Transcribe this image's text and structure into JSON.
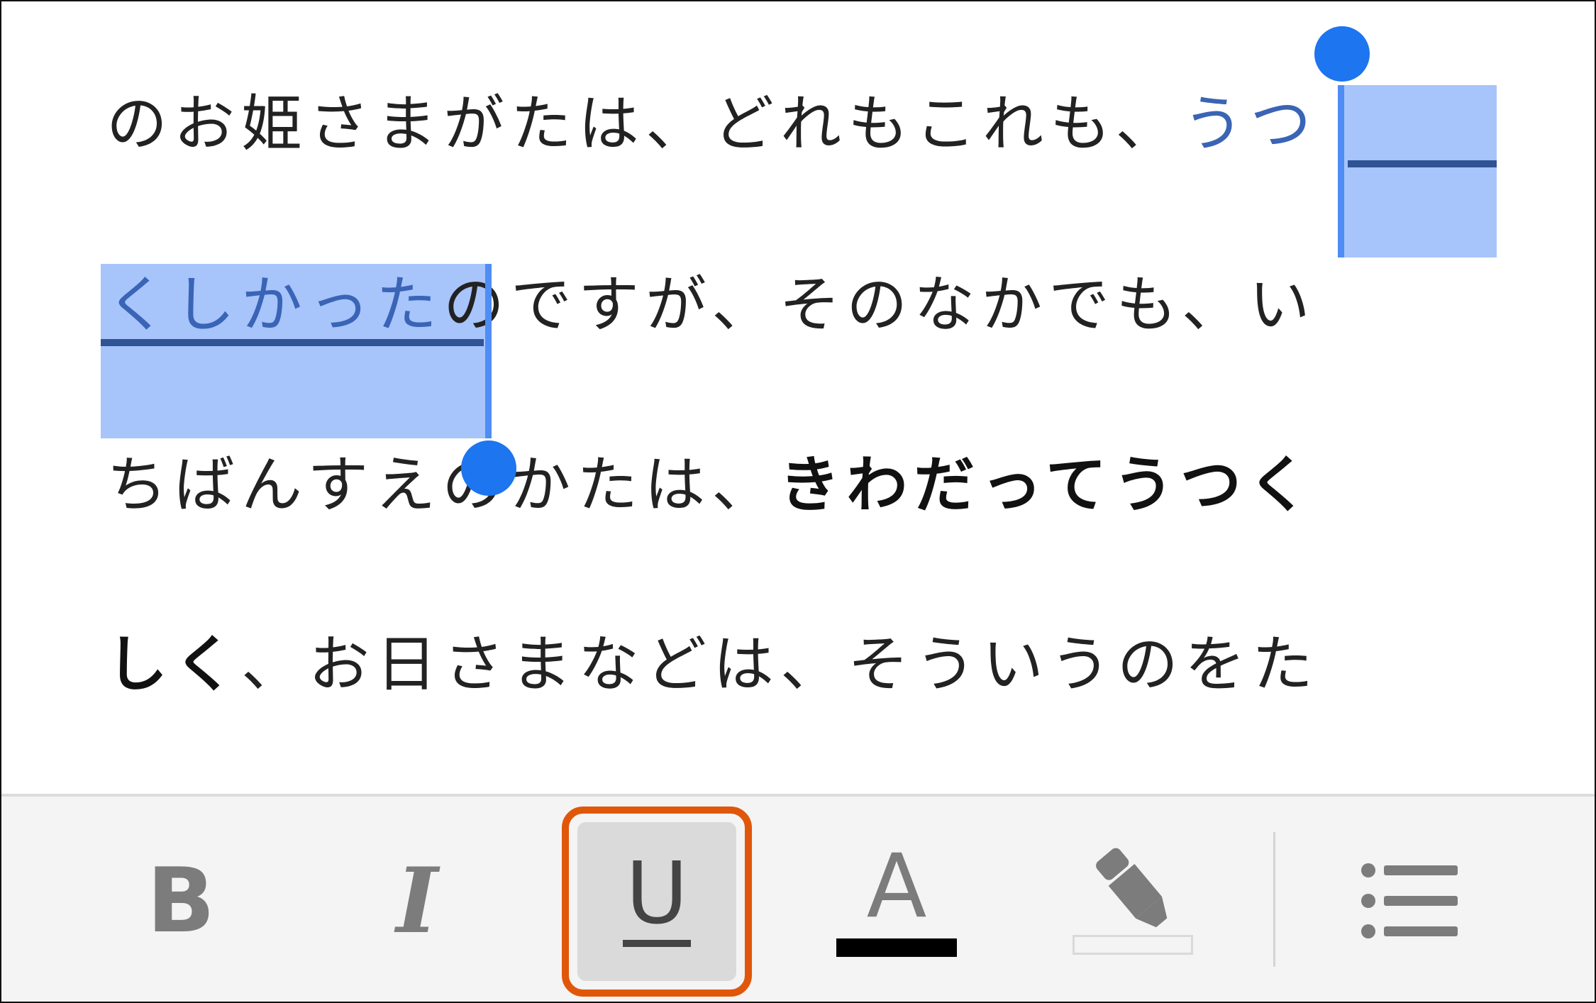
{
  "editor": {
    "lines": [
      {
        "before": "のお姫さまがたは、どれもこれも、",
        "selected": "うつ"
      },
      {
        "selected": "くしかった",
        "after": "のですが、そのなかでも、い"
      },
      {
        "before": "ちばんすえのかたは、",
        "bold": "きわだってうつく"
      },
      {
        "bold": "しく",
        "after": "、お日さまなどは、そういうのをた"
      }
    ]
  },
  "toolbar": {
    "bold_label": "B",
    "italic_label": "I",
    "underline_label": "U",
    "text_color_label": "A",
    "text_color_swatch": "#000000",
    "accent_highlight": "#e0570a",
    "selection_color": "#a7c4fb"
  }
}
